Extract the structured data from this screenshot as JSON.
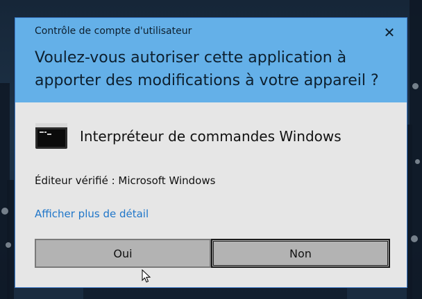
{
  "dialog": {
    "window_title": "Contrôle de compte d'utilisateur",
    "question": "Voulez-vous autoriser cette application à apporter des modifications à votre appareil ?",
    "close_glyph": "✕",
    "app_name": "Interpréteur de commandes Windows",
    "publisher": "Éditeur vérifié : Microsoft Windows",
    "details_link": "Afficher plus de détail",
    "yes_label": "Oui",
    "no_label": "Non"
  },
  "icons": {
    "app": "command-prompt-icon",
    "close": "close-icon",
    "pointer": "mouse-cursor-icon"
  },
  "colors": {
    "header_background": "#64b0e8",
    "body_background": "#e6e6e6",
    "link": "#1f76c9",
    "button_background": "#b3b3b3"
  }
}
